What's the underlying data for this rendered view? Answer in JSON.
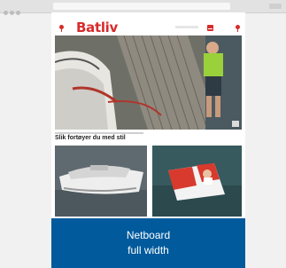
{
  "site": {
    "logo": "Batliv"
  },
  "hero": {
    "title": "Slik fortøyer du med stil"
  },
  "ad": {
    "line1": "Netboard",
    "line2": "full width"
  },
  "icons": {
    "left": "location-pin-icon",
    "mail": "mail-icon",
    "user": "user-icon"
  },
  "colors": {
    "brand": "#d82b2b",
    "ad_background": "#005a9c"
  }
}
